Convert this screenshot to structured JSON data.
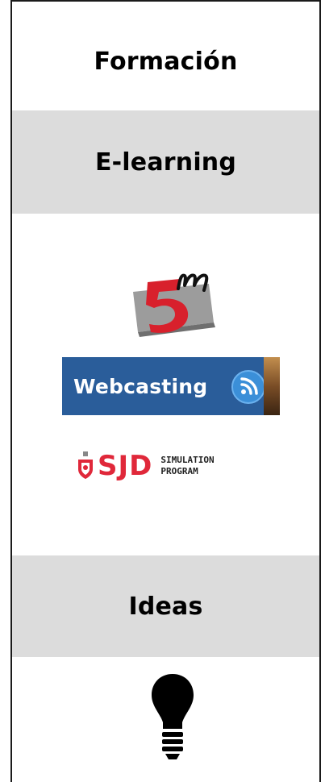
{
  "sections": {
    "formacion": {
      "title": "Formación"
    },
    "elearning": {
      "title": "E-learning"
    },
    "ideas": {
      "title": "Ideas"
    }
  },
  "links": {
    "webcasting": {
      "label": "Webcasting",
      "icon": "rss-icon"
    },
    "logo_5m": {
      "label": "5m",
      "icon": "five-m-logo"
    },
    "sjd": {
      "brand": "SJD",
      "subtitle_line1": "SIMULATION",
      "subtitle_line2": "PROGRAM"
    }
  },
  "icons": {
    "ideas": "lightbulb-icon"
  },
  "colors": {
    "section_gray": "#dcdcdc",
    "webcasting_blue": "#2a5d9a",
    "sjd_red": "#e0283a",
    "border": "#1a1a1a"
  }
}
